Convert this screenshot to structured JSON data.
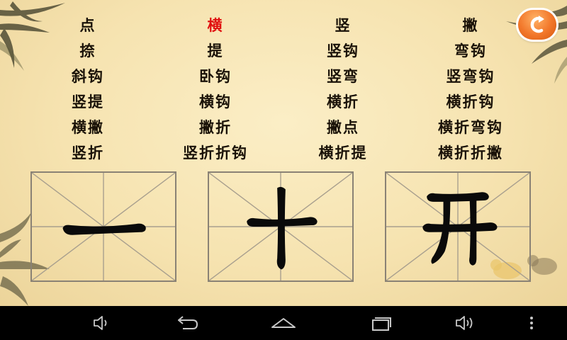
{
  "strokes": {
    "selected_index": 1,
    "rows": [
      [
        "点",
        "横",
        "竖",
        "撇"
      ],
      [
        "捺",
        "提",
        "竖钩",
        "弯钩"
      ],
      [
        "斜钩",
        "卧钩",
        "竖弯",
        "竖弯钩"
      ],
      [
        "竖提",
        "横钩",
        "横折",
        "横折钩"
      ],
      [
        "横撇",
        "撇折",
        "撇点",
        "横折弯钩"
      ],
      [
        "竖折",
        "竖折折钩",
        "横折提",
        "横折折撇"
      ]
    ]
  },
  "practice_boxes": [
    {
      "character": "一"
    },
    {
      "character": "十"
    },
    {
      "character": "开"
    }
  ],
  "back_button": {
    "icon": "back-arrow-icon",
    "color": "#f2772a"
  },
  "navbar": {
    "buttons": [
      "volume-down-icon",
      "back-icon",
      "home-icon",
      "recent-apps-icon",
      "volume-up-icon",
      "menu-icon"
    ]
  }
}
